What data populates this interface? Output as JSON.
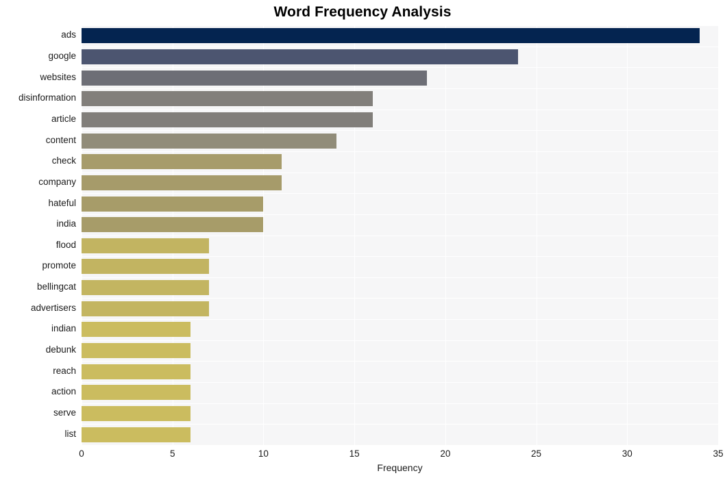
{
  "chart_data": {
    "type": "bar",
    "orientation": "horizontal",
    "title": "Word Frequency Analysis",
    "xlabel": "Frequency",
    "ylabel": "",
    "xlim": [
      0,
      35
    ],
    "ylim": null,
    "xticks": [
      "0",
      "5",
      "10",
      "15",
      "20",
      "25",
      "30",
      "35"
    ],
    "xtick_values": [
      0,
      5,
      10,
      15,
      20,
      25,
      30,
      35
    ],
    "grid": true,
    "grid_color": "#ffffff",
    "plot_background": "#f6f6f7",
    "figure_background": "#ffffff",
    "legend": null,
    "categories": [
      "ads",
      "google",
      "websites",
      "disinformation",
      "article",
      "content",
      "check",
      "company",
      "hateful",
      "india",
      "flood",
      "promote",
      "bellingcat",
      "advertisers",
      "indian",
      "debunk",
      "reach",
      "action",
      "serve",
      "list"
    ],
    "values": [
      34,
      24,
      19,
      16,
      16,
      14,
      11,
      11,
      10,
      10,
      7,
      7,
      7,
      7,
      6,
      6,
      6,
      6,
      6,
      6
    ],
    "bar_colors": [
      "#042450",
      "#4c5570",
      "#6d6e76",
      "#827f7b",
      "#817e7a",
      "#918c79",
      "#a79c6b",
      "#a69b6a",
      "#a79c69",
      "#a79c69",
      "#c2b461",
      "#c2b461",
      "#c3b561",
      "#c3b561",
      "#cbbc5f",
      "#cbbc5f",
      "#cbbc5f",
      "#cbbc5f",
      "#cbbc5f",
      "#cbbc5f"
    ]
  }
}
